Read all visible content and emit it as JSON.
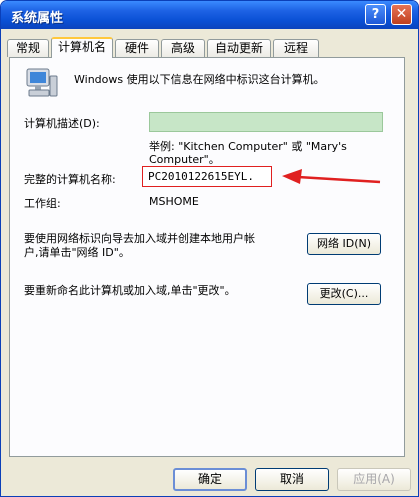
{
  "window": {
    "title": "系统属性",
    "help_glyph": "?",
    "close_glyph": "✕"
  },
  "tabs": [
    {
      "label": "常规",
      "active": false
    },
    {
      "label": "计算机名",
      "active": true
    },
    {
      "label": "硬件",
      "active": false
    },
    {
      "label": "高级",
      "active": false
    },
    {
      "label": "自动更新",
      "active": false
    },
    {
      "label": "远程",
      "active": false
    }
  ],
  "info_text": "Windows 使用以下信息在网络中标识这台计算机。",
  "description": {
    "label": "计算机描述(D):",
    "value": "",
    "example_line1": "举例: \"Kitchen Computer\" 或 \"Mary's",
    "example_line2": "Computer\"。"
  },
  "full_name": {
    "label": "完整的计算机名称:",
    "value": "PC2010122615EYL."
  },
  "workgroup": {
    "label": "工作组:",
    "value": "MSHOME"
  },
  "network_id": {
    "text_line1": "要使用网络标识向导去加入域并创建本地用户帐",
    "text_line2": "户,请单击\"网络 ID\"。",
    "button": "网络 ID(N)"
  },
  "rename": {
    "text": "要重新命名此计算机或加入域,单击\"更改\"。",
    "button": "更改(C)..."
  },
  "footer": {
    "ok": "确定",
    "cancel": "取消",
    "apply": "应用(A)"
  },
  "colors": {
    "title_bar": "#0a50d5",
    "highlight_box": "#e02020",
    "arrow": "#e02020",
    "desc_field": "#c7e6c7"
  },
  "icons": {
    "computer": "computer-icon",
    "arrow": "annotation-arrow-icon"
  }
}
